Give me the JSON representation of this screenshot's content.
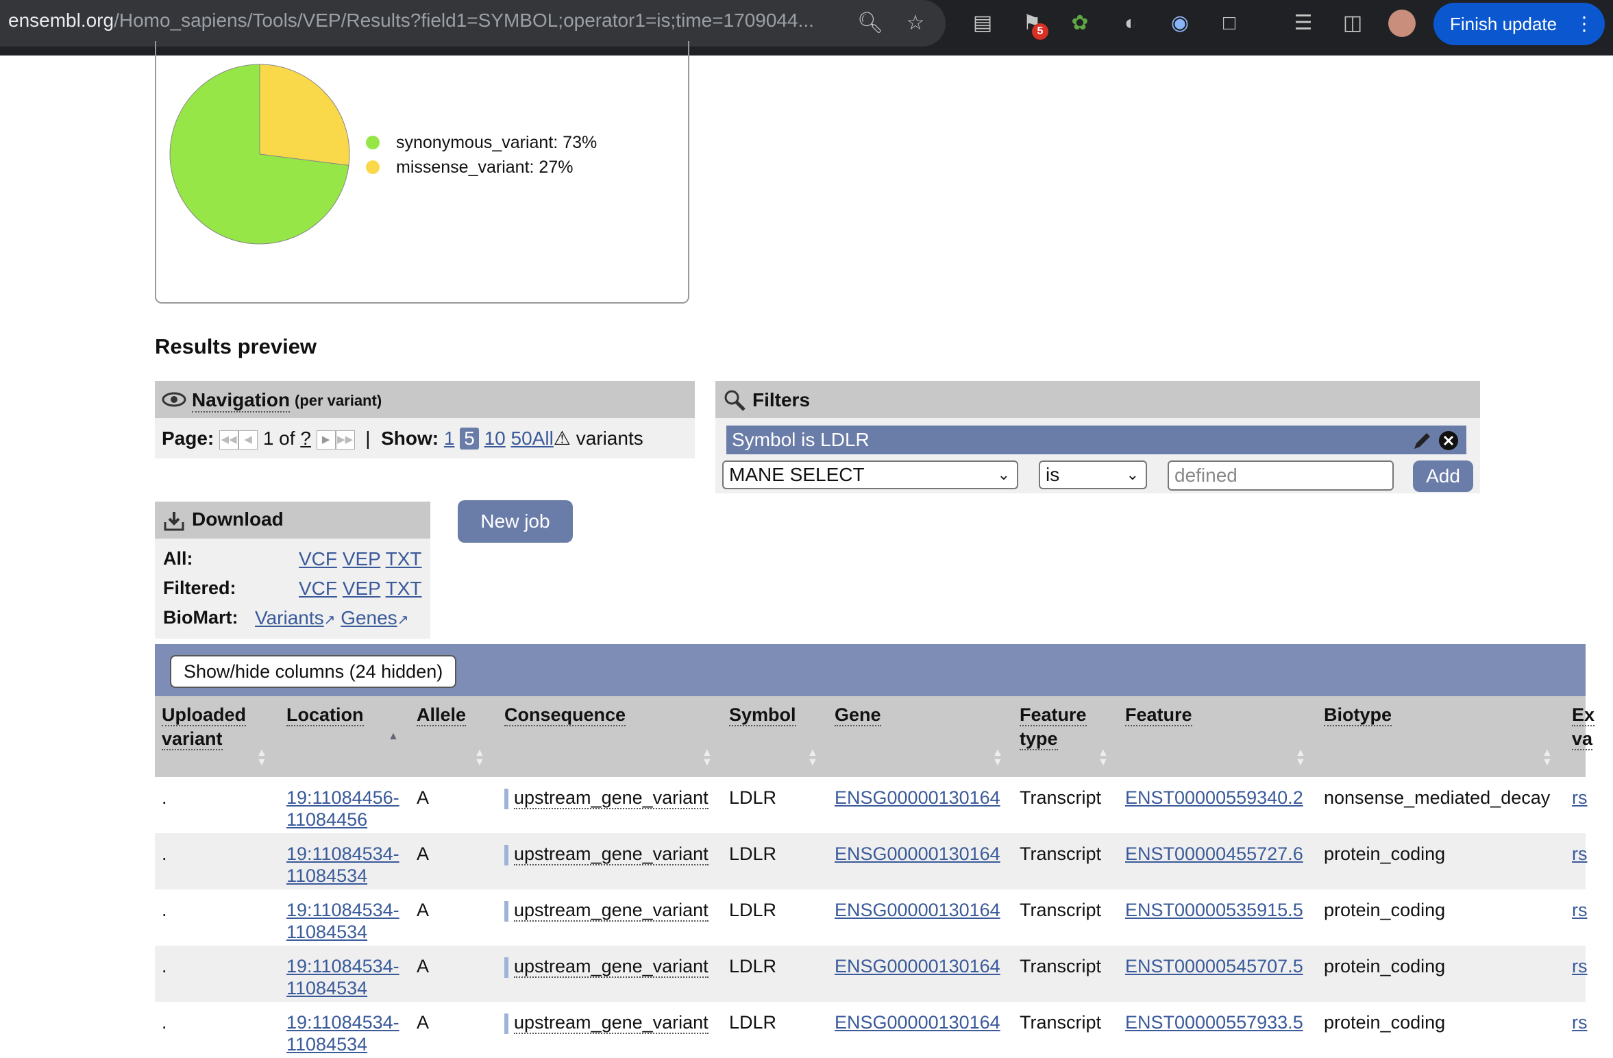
{
  "browser": {
    "url_domain": "ensembl.org",
    "url_path": "/Homo_sapiens/Tools/VEP/Results?field1=SYMBOL;operator1=is;time=1709044...",
    "extension_badge": "5",
    "finish_update": "Finish update"
  },
  "pie": {
    "slices": [
      {
        "label": "synonymous_variant: 73%",
        "value": 73,
        "color": "#95e646"
      },
      {
        "label": "missense_variant: 27%",
        "value": 27,
        "color": "#f9d94a"
      }
    ]
  },
  "results_title": "Results preview",
  "navigation": {
    "title": "Navigation",
    "subtitle": "(per variant)",
    "page_label": "Page:",
    "page_value": "1",
    "of": "of",
    "total": "?",
    "sep": "|",
    "show_label": "Show:",
    "show_options": [
      "1",
      "5",
      "10",
      "50",
      "All"
    ],
    "show_selected": "5",
    "variants": "variants"
  },
  "filters": {
    "title": "Filters",
    "active": "Symbol is LDLR",
    "field_select": "MANE SELECT",
    "operator_select": "is",
    "value_placeholder": "defined",
    "add": "Add"
  },
  "download": {
    "title": "Download",
    "rows": [
      {
        "label": "All:",
        "links": [
          "VCF",
          "VEP",
          "TXT"
        ]
      },
      {
        "label": "Filtered:",
        "links": [
          "VCF",
          "VEP",
          "TXT"
        ]
      },
      {
        "label": "BioMart:",
        "links": [
          "Variants",
          "Genes"
        ]
      }
    ]
  },
  "new_job": "New job",
  "table": {
    "show_hide": "Show/hide columns (24 hidden)",
    "headers": [
      {
        "l1": "Uploaded",
        "l2": "variant"
      },
      {
        "l1": "Location",
        "l2": ""
      },
      {
        "l1": "Allele",
        "l2": ""
      },
      {
        "l1": "Consequence",
        "l2": ""
      },
      {
        "l1": "Symbol",
        "l2": ""
      },
      {
        "l1": "Gene",
        "l2": ""
      },
      {
        "l1": "Feature",
        "l2": "type"
      },
      {
        "l1": "Feature",
        "l2": ""
      },
      {
        "l1": "Biotype",
        "l2": ""
      },
      {
        "l1": "Ex",
        "l2": "va"
      }
    ],
    "rows": [
      {
        "uploaded": ".",
        "loc1": "19:11084456-",
        "loc2": "11084456",
        "allele": "A",
        "consequence": "upstream_gene_variant",
        "symbol": "LDLR",
        "gene": "ENSG00000130164",
        "ftype": "Transcript",
        "feature": "ENST00000559340.2",
        "biotype": "nonsense_mediated_decay",
        "ex": "rs"
      },
      {
        "uploaded": ".",
        "loc1": "19:11084534-",
        "loc2": "11084534",
        "allele": "A",
        "consequence": "upstream_gene_variant",
        "symbol": "LDLR",
        "gene": "ENSG00000130164",
        "ftype": "Transcript",
        "feature": "ENST00000455727.6",
        "biotype": "protein_coding",
        "ex": "rs"
      },
      {
        "uploaded": ".",
        "loc1": "19:11084534-",
        "loc2": "11084534",
        "allele": "A",
        "consequence": "upstream_gene_variant",
        "symbol": "LDLR",
        "gene": "ENSG00000130164",
        "ftype": "Transcript",
        "feature": "ENST00000535915.5",
        "biotype": "protein_coding",
        "ex": "rs"
      },
      {
        "uploaded": ".",
        "loc1": "19:11084534-",
        "loc2": "11084534",
        "allele": "A",
        "consequence": "upstream_gene_variant",
        "symbol": "LDLR",
        "gene": "ENSG00000130164",
        "ftype": "Transcript",
        "feature": "ENST00000545707.5",
        "biotype": "protein_coding",
        "ex": "rs"
      },
      {
        "uploaded": ".",
        "loc1": "19:11084534-",
        "loc2": "11084534",
        "allele": "A",
        "consequence": "upstream_gene_variant",
        "symbol": "LDLR",
        "gene": "ENSG00000130164",
        "ftype": "Transcript",
        "feature": "ENST00000557933.5",
        "biotype": "protein_coding",
        "ex": "rs"
      }
    ]
  }
}
